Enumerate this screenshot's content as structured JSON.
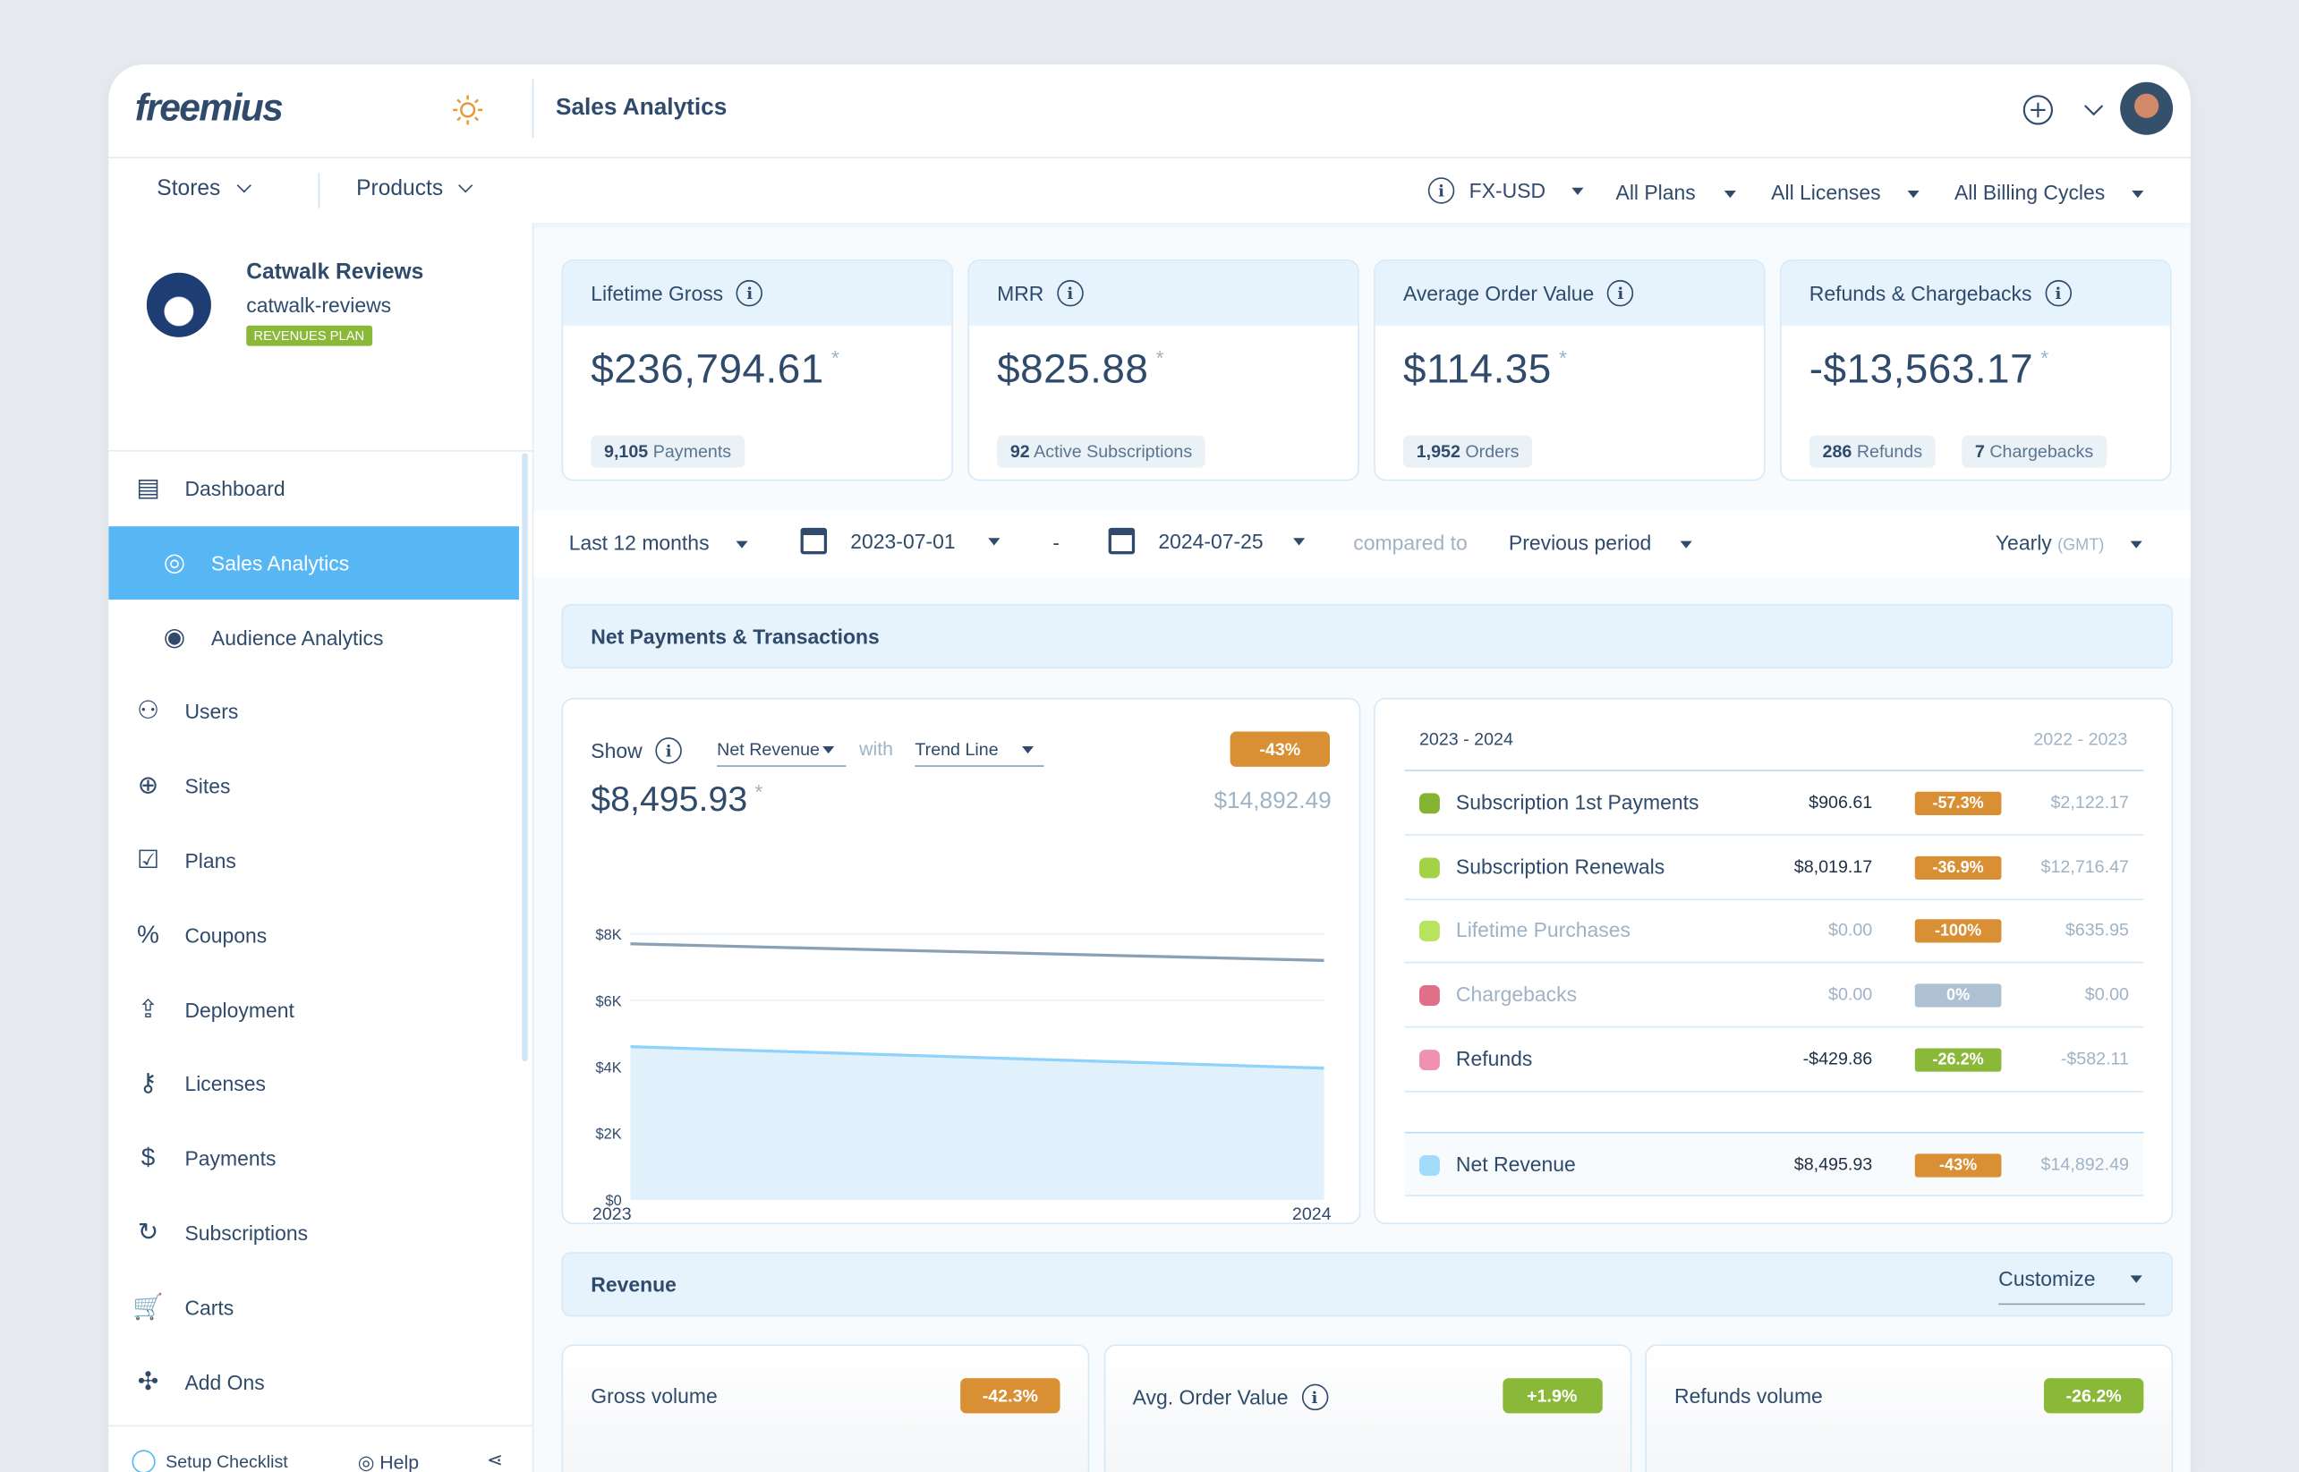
{
  "header": {
    "logo": "freemius",
    "title": "Sales Analytics"
  },
  "nav_top": {
    "stores": "Stores",
    "products": "Products"
  },
  "filters": {
    "currency": "FX-USD",
    "plans": "All Plans",
    "licenses": "All Licenses",
    "billing": "All Billing Cycles"
  },
  "product": {
    "name": "Catwalk Reviews",
    "slug": "catwalk-reviews",
    "plan_badge": "REVENUES PLAN"
  },
  "sidebar": {
    "items": [
      {
        "label": "Dashboard",
        "icon": "dashboard-icon"
      },
      {
        "label": "Sales Analytics",
        "icon": "sales-analytics-icon",
        "active": true
      },
      {
        "label": "Audience Analytics",
        "icon": "audience-icon"
      },
      {
        "label": "Users",
        "icon": "users-icon"
      },
      {
        "label": "Sites",
        "icon": "globe-icon"
      },
      {
        "label": "Plans",
        "icon": "plans-icon"
      },
      {
        "label": "Coupons",
        "icon": "coupon-icon"
      },
      {
        "label": "Deployment",
        "icon": "upload-icon"
      },
      {
        "label": "Licenses",
        "icon": "key-icon"
      },
      {
        "label": "Payments",
        "icon": "payments-icon"
      },
      {
        "label": "Subscriptions",
        "icon": "subscriptions-icon"
      },
      {
        "label": "Carts",
        "icon": "cart-icon"
      },
      {
        "label": "Add Ons",
        "icon": "puzzle-icon"
      }
    ],
    "footer": {
      "setup": "Setup Checklist",
      "help": "Help"
    }
  },
  "kpis": [
    {
      "title": "Lifetime Gross",
      "value": "$236,794.61",
      "pills": [
        {
          "num": "9,105",
          "text": "Payments"
        }
      ]
    },
    {
      "title": "MRR",
      "value": "$825.88",
      "pills": [
        {
          "num": "92",
          "text": "Active Subscriptions"
        }
      ]
    },
    {
      "title": "Average Order Value",
      "value": "$114.35",
      "pills": [
        {
          "num": "1,952",
          "text": "Orders"
        }
      ]
    },
    {
      "title": "Refunds & Chargebacks",
      "value": "-$13,563.17",
      "pills": [
        {
          "num": "286",
          "text": "Refunds"
        },
        {
          "num": "7",
          "text": "Chargebacks"
        }
      ]
    }
  ],
  "daterow": {
    "range": "Last 12 months",
    "start": "2023-07-01",
    "sep": "-",
    "end": "2024-07-25",
    "compared": "compared to",
    "compare_value": "Previous period",
    "granularity": "Yearly",
    "tz": "(GMT)"
  },
  "net_section": {
    "title": "Net Payments & Transactions"
  },
  "chart_panel": {
    "show": "Show",
    "metric": "Net Revenue",
    "with": "with",
    "overlay": "Trend Line",
    "change": "-43%",
    "value": "$8,495.93",
    "prev_value": "$14,892.49"
  },
  "chart_data": {
    "type": "area",
    "categories": [
      "2023",
      "2024"
    ],
    "yticks": [
      "$0",
      "$2K",
      "$4K",
      "$6K",
      "$8K"
    ],
    "ylim": [
      0,
      8000
    ],
    "series": [
      {
        "values": [
          4600,
          3950
        ],
        "color": "#8fd3fb"
      },
      {
        "values": [
          7700,
          7200
        ],
        "color": "#8aa0b4"
      }
    ]
  },
  "table": {
    "cur_period": "2023 - 2024",
    "prev_period": "2022 - 2023",
    "rows": [
      {
        "label": "Subscription 1st Payments",
        "cur": "$906.61",
        "change": "-57.3%",
        "prev": "$2,122.17",
        "color": "#84b432",
        "badge": "or"
      },
      {
        "label": "Subscription Renewals",
        "cur": "$8,019.17",
        "change": "-36.9%",
        "prev": "$12,716.47",
        "color": "#a3d247",
        "badge": "or"
      },
      {
        "label": "Lifetime Purchases",
        "cur": "$0.00",
        "change": "-100%",
        "prev": "$635.95",
        "color": "#b7e35f",
        "badge": "or",
        "muted": true
      },
      {
        "label": "Chargebacks",
        "cur": "$0.00",
        "change": "0%",
        "prev": "$0.00",
        "color": "#e06f88",
        "badge": "gy",
        "muted": true
      },
      {
        "label": "Refunds",
        "cur": "-$429.86",
        "change": "-26.2%",
        "prev": "-$582.11",
        "color": "#f091b1",
        "badge": "gr"
      }
    ],
    "total": {
      "label": "Net Revenue",
      "cur": "$8,495.93",
      "change": "-43%",
      "prev": "$14,892.49",
      "color": "#a3dbfb"
    }
  },
  "revenue_section": {
    "title": "Revenue",
    "customize": "Customize"
  },
  "bottom_cards": [
    {
      "title": "Gross volume",
      "change": "-42.3%",
      "badge": "or"
    },
    {
      "title": "Avg. Order Value",
      "change": "+1.9%",
      "badge": "gr",
      "info": true
    },
    {
      "title": "Refunds volume",
      "change": "-26.2%",
      "badge": "gr"
    }
  ]
}
